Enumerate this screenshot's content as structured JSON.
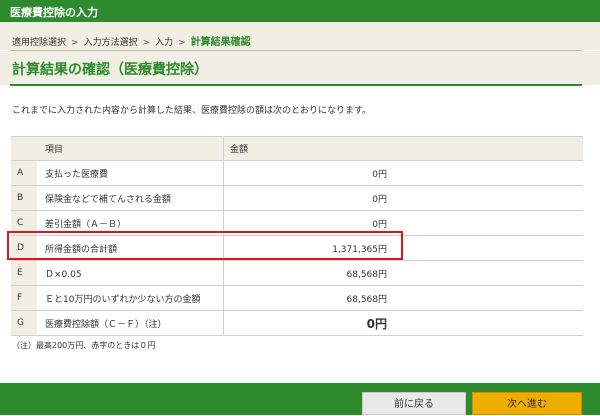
{
  "header": {
    "title": "医療費控除の入力"
  },
  "breadcrumb": {
    "steps": [
      "適用控除選択",
      "入力方法選択",
      "入力",
      "計算結果確認"
    ],
    "separator": ">"
  },
  "page": {
    "title": "計算結果の確認（医療費控除）",
    "description": "これまでに入力された内容から計算した結果、医療費控除の額は次のとおりになります。"
  },
  "table": {
    "headers": {
      "item": "項目",
      "amount": "金額"
    },
    "rows": [
      {
        "letter": "A",
        "item": "支払った医療費",
        "amount": "0円"
      },
      {
        "letter": "B",
        "item": "保険金などで補てんされる金額",
        "amount": "0円"
      },
      {
        "letter": "C",
        "item": "差引金額（Ａ－Ｂ）",
        "amount": "0円"
      },
      {
        "letter": "D",
        "item": "所得金額の合計額",
        "amount": "1,371,365円"
      },
      {
        "letter": "E",
        "item": "Ｄ×0.05",
        "amount": "68,568円"
      },
      {
        "letter": "F",
        "item": "Ｅと10万円のいずれか少ない方の金額",
        "amount": "68,568円"
      },
      {
        "letter": "G",
        "item": "医療費控除額（Ｃ－Ｆ）（注）",
        "amount": "0円"
      }
    ]
  },
  "note": "（注）最高200万円、赤字のときは０円",
  "buttons": {
    "back": "前に戻る",
    "next": "次へ進む"
  },
  "colors": {
    "brand_green": "#2d8a2d",
    "highlight_red": "#e0141e",
    "next_button": "#f0ac00"
  }
}
